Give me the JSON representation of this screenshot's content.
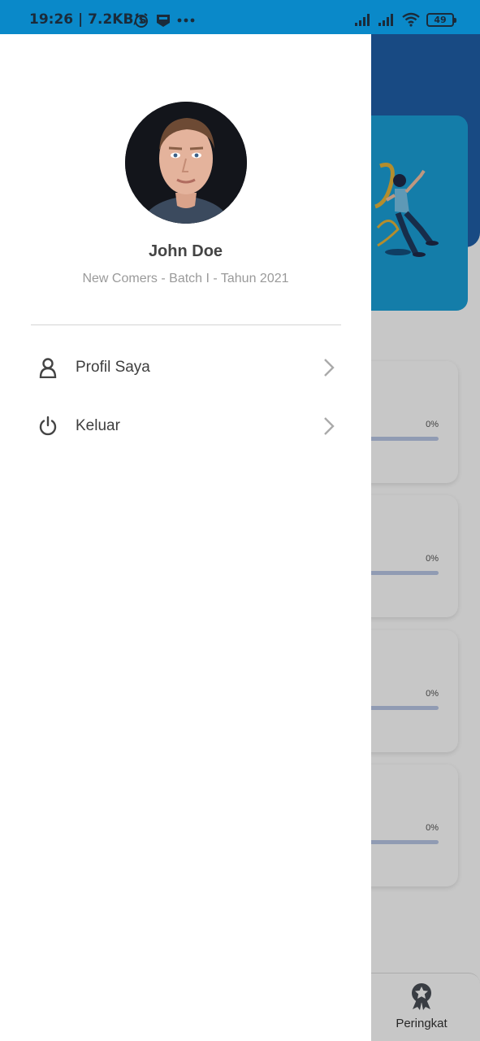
{
  "status_bar": {
    "time": "19:26 | 7.2KB/s",
    "battery": "49",
    "icons": [
      "alarm-icon",
      "app-notification-icon",
      "more-dots-icon",
      "signal-icon",
      "signal-icon",
      "wifi-icon",
      "battery-icon"
    ]
  },
  "drawer": {
    "profile": {
      "name": "John Doe",
      "subtitle": "New Comers - Batch I - Tahun 2021"
    },
    "menu": [
      {
        "label": "Profil Saya",
        "icon": "user-icon"
      },
      {
        "label": "Keluar",
        "icon": "power-icon"
      }
    ]
  },
  "background": {
    "courses": [
      {
        "progress_text": "0%",
        "progress": 0
      },
      {
        "progress_text": "0%",
        "progress": 0
      },
      {
        "progress_text": "0%",
        "progress": 0
      },
      {
        "progress_text": "0%",
        "progress": 0
      }
    ],
    "bottom_nav": {
      "label": "Peringkat",
      "icon": "ribbon-badge-icon"
    }
  },
  "colors": {
    "status_bar": "#0a89c9",
    "header": "#1f5fa8",
    "hero_card": "#1aa0d9"
  }
}
